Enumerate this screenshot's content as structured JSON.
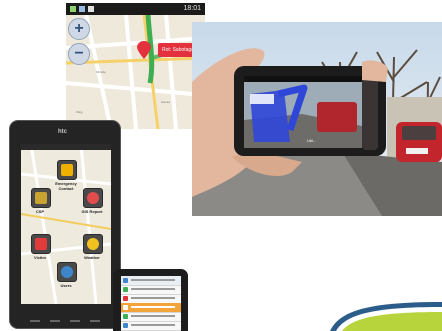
{
  "map_screenshot": {
    "status_time": "18:01",
    "zoom_in_symbol": "+",
    "zoom_out_symbol": "−",
    "popup_text": "Rot: Sabotage"
  },
  "phone_left": {
    "brand": "htc",
    "apps": [
      {
        "label": "Emergency Contact",
        "icon": "fire-icon",
        "color": "#f0b000"
      },
      {
        "label": "CSP",
        "icon": "grid-icon",
        "color": "#c9a230"
      },
      {
        "label": "GIS Report",
        "icon": "alert-icon",
        "color": "#e34c4c"
      },
      {
        "label": "Victim",
        "icon": "cross-icon",
        "color": "#e23b3b"
      },
      {
        "label": "Weather",
        "icon": "sun-icon",
        "color": "#f2c21f"
      },
      {
        "label": "Users",
        "icon": "globe-icon",
        "color": "#3e86c9"
      }
    ]
  },
  "ar_photo": {
    "phone_overlay_caption": "Ubi..."
  },
  "colors": {
    "ar_blue": "#2f47d9",
    "car_red": "#c2252c",
    "map_green": "#3fae52"
  }
}
